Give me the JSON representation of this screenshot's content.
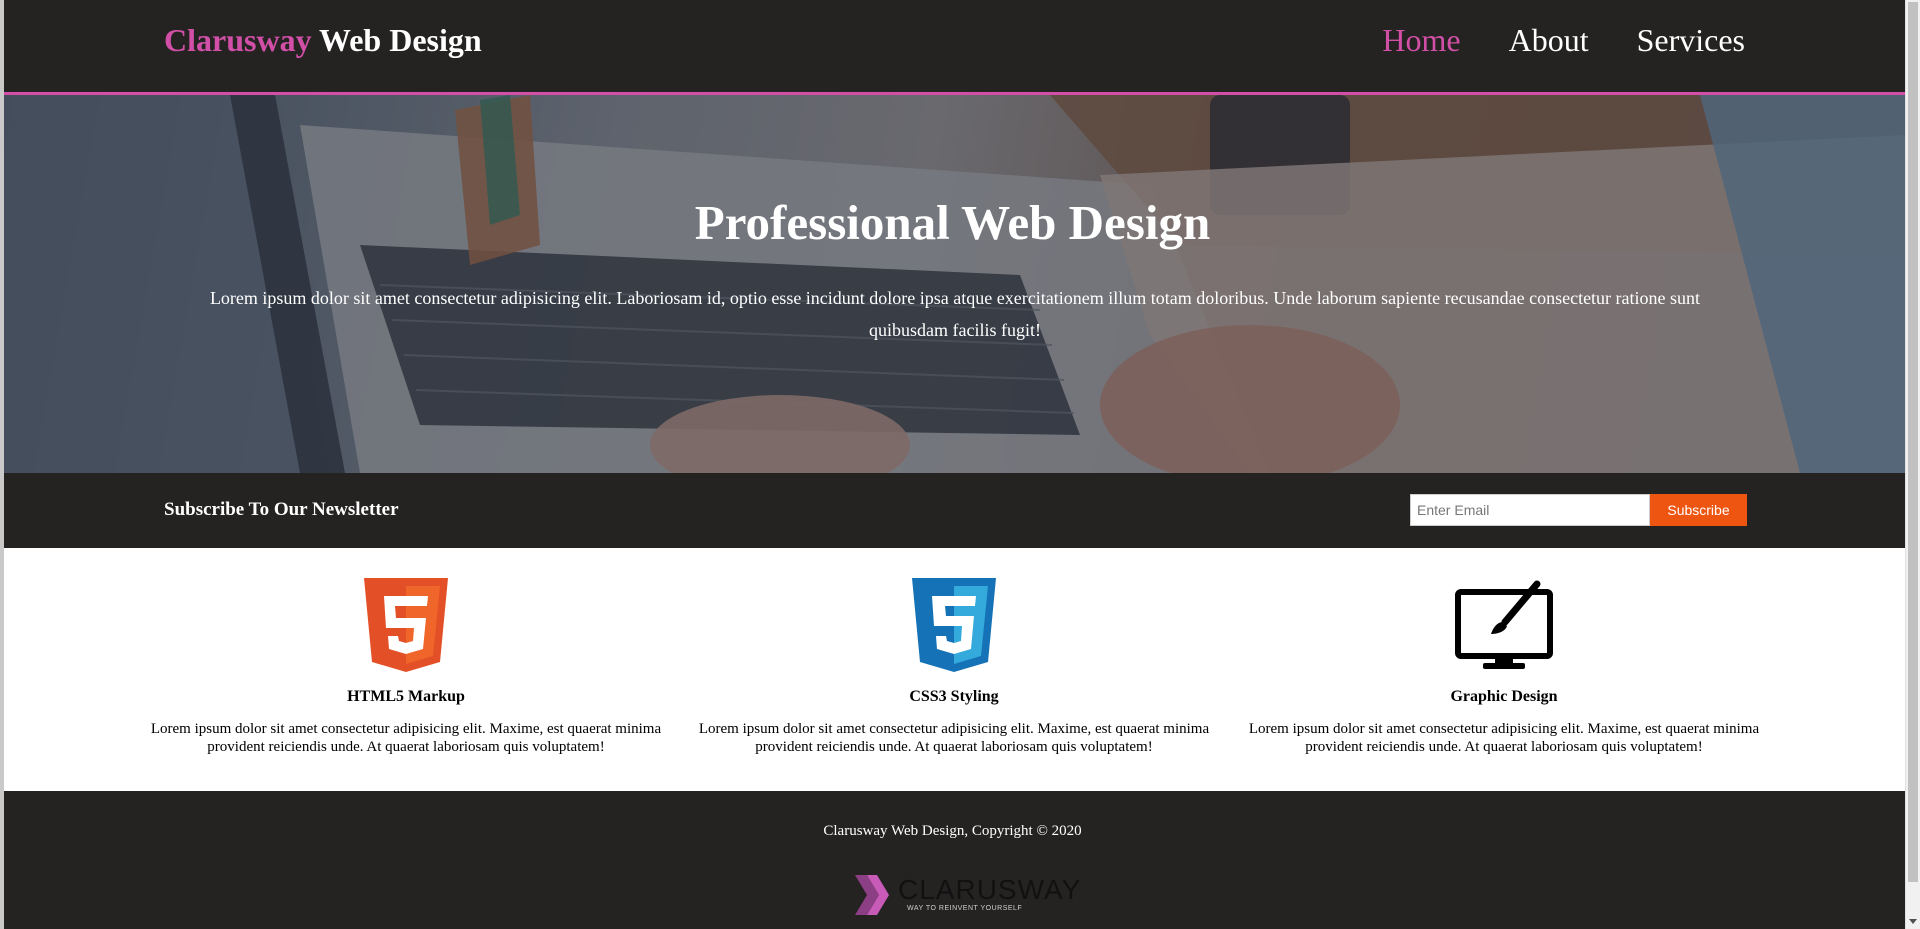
{
  "header": {
    "logo_accent": "Clarusway",
    "logo_rest": " Web Design",
    "nav": {
      "home": "Home",
      "about": "About",
      "services": "Services"
    }
  },
  "hero": {
    "title": "Professional Web Design",
    "text": "Lorem ipsum dolor sit amet consectetur adipisicing elit. Laboriosam id, optio esse incidunt dolore ipsa atque exercitationem illum totam doloribus. Unde laborum sapiente recusandae consectetur ratione sunt quibusdam facilis fugit!"
  },
  "newsletter": {
    "heading": "Subscribe To Our Newsletter",
    "email_placeholder": "Enter Email",
    "email_value": "",
    "button_label": "Subscribe"
  },
  "features": [
    {
      "icon": "html5-icon",
      "title": "HTML5 Markup",
      "text": "Lorem ipsum dolor sit amet consectetur adipisicing elit. Maxime, est quaerat minima provident reiciendis unde. At quaerat laboriosam quis voluptatem!"
    },
    {
      "icon": "css3-icon",
      "title": "CSS3 Styling",
      "text": "Lorem ipsum dolor sit amet consectetur adipisicing elit. Maxime, est quaerat minima provident reiciendis unde. At quaerat laboriosam quis voluptatem!"
    },
    {
      "icon": "monitor-brush-icon",
      "title": "Graphic Design",
      "text": "Lorem ipsum dolor sit amet consectetur adipisicing elit. Maxime, est quaerat minima provident reiciendis unde. At quaerat laboriosam quis voluptatem!"
    }
  ],
  "footer": {
    "copyright": "Clarusway Web Design, Copyright © 2020",
    "brand_name": "CLARUSWAY",
    "brand_tagline": "WAY TO REINVENT YOURSELF"
  },
  "colors": {
    "accent": "#d24fa8",
    "dark_bg": "#252322",
    "subscribe": "#ee5511",
    "html5": "#e34f26",
    "css3": "#1572b6"
  }
}
